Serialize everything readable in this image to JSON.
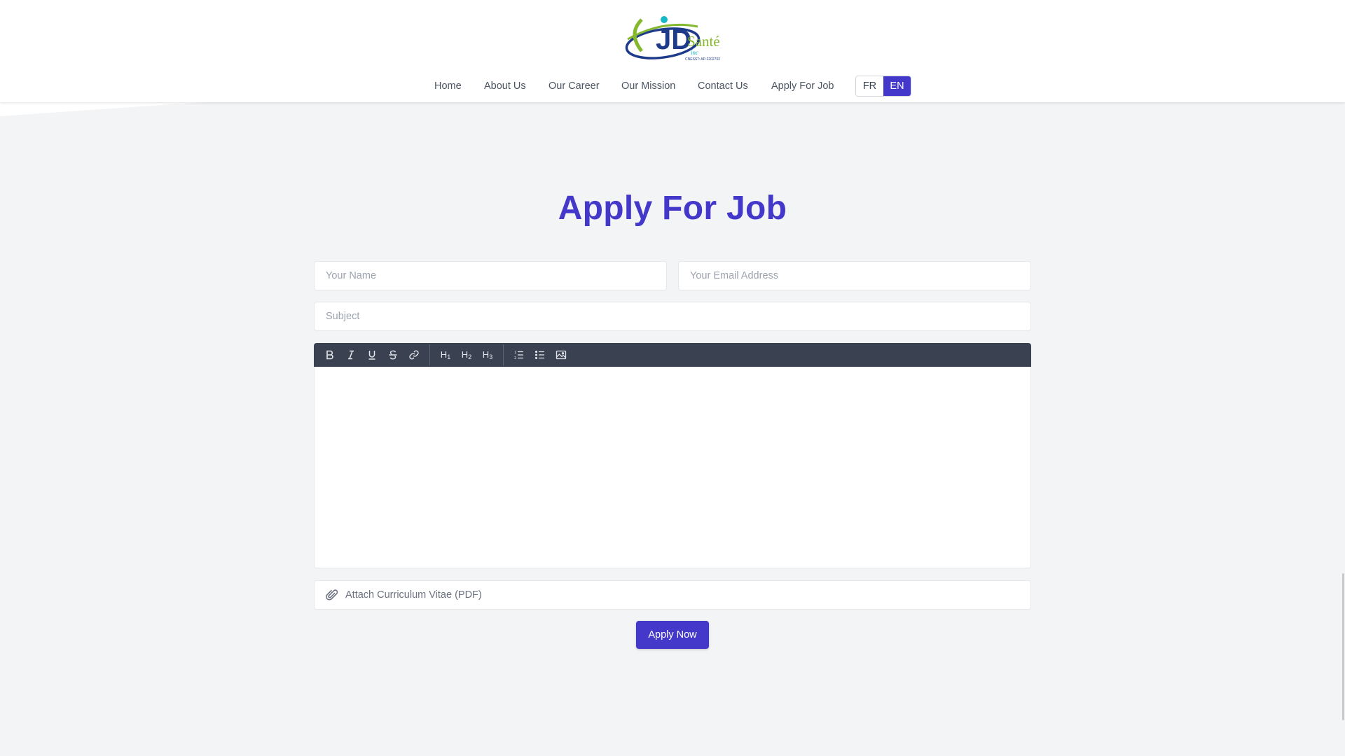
{
  "header": {
    "logo": {
      "brand": "JD",
      "name": "Santé",
      "suffix": "inc",
      "registration": "CNESST: AP-2202702",
      "colors": {
        "navy": "#1e3a8a",
        "green": "#84b82d",
        "cyan": "#14b8c8"
      }
    },
    "nav": [
      {
        "label": "Home"
      },
      {
        "label": "About Us"
      },
      {
        "label": "Our Career"
      },
      {
        "label": "Our Mission"
      },
      {
        "label": "Contact Us"
      },
      {
        "label": "Apply For Job"
      }
    ],
    "languages": {
      "fr": "FR",
      "en": "EN",
      "active": "EN"
    }
  },
  "main": {
    "title": "Apply For Job",
    "form": {
      "name_placeholder": "Your Name",
      "email_placeholder": "Your Email Address",
      "subject_placeholder": "Subject",
      "editor_content": "",
      "toolbar": {
        "bold": "bold-icon",
        "italic": "italic-icon",
        "underline": "underline-icon",
        "strike": "strikethrough-icon",
        "link": "link-icon",
        "h1": "H",
        "h1_sub": "1",
        "h2": "H",
        "h2_sub": "2",
        "h3": "H",
        "h3_sub": "3",
        "ordered_list": "ordered-list-icon",
        "bullet_list": "bullet-list-icon",
        "image": "image-icon"
      },
      "attach_label": "Attach Curriculum Vitae (PDF)",
      "submit_label": "Apply Now"
    }
  },
  "colors": {
    "accent": "#4338ca",
    "toolbar": "#3a4252",
    "background": "#f3f4f6"
  }
}
